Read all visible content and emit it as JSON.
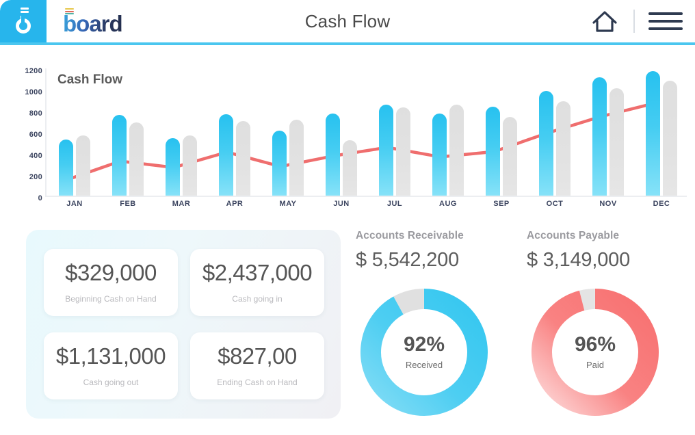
{
  "header": {
    "brand_name": "board",
    "page_title": "Cash Flow",
    "home_icon": "home-icon",
    "menu_icon": "hamburger-menu-icon",
    "accent": "#27b5ec",
    "rule_color": "#4bc6ef"
  },
  "chart_data": {
    "type": "bar",
    "title": "Cash Flow",
    "xlabel": "",
    "ylabel": "",
    "ylim": [
      0,
      1200
    ],
    "yticks": [
      0,
      200,
      400,
      600,
      800,
      1000,
      1200
    ],
    "grid": false,
    "legend": "none",
    "categories": [
      "JAN",
      "FEB",
      "MAR",
      "APR",
      "MAY",
      "JUN",
      "JUL",
      "AUG",
      "SEP",
      "OCT",
      "NOV",
      "DEC"
    ],
    "series": [
      {
        "name": "Cash going in",
        "type": "bar",
        "color": "#27c1ef",
        "values": [
          530,
          760,
          540,
          765,
          615,
          775,
          860,
          775,
          840,
          985,
          1115,
          1175
        ]
      },
      {
        "name": "Cash going out",
        "type": "bar",
        "color": "#e2e2e2",
        "values": [
          565,
          690,
          565,
          705,
          715,
          520,
          835,
          855,
          740,
          890,
          1010,
          1085
        ]
      },
      {
        "name": "Net cash",
        "type": "line",
        "color": "#ef6e6e",
        "values": [
          150,
          325,
          265,
          410,
          275,
          375,
          455,
          365,
          415,
          590,
          745,
          870
        ]
      }
    ]
  },
  "kpi_panel": {
    "cards": [
      {
        "value": "$329,000",
        "label": "Beginning Cash on Hand"
      },
      {
        "value": "$2,437,000",
        "label": "Cash going in"
      },
      {
        "value": "$1,131,000",
        "label": "Cash going out"
      },
      {
        "value": "$827,00",
        "label": "Ending Cash on Hand"
      }
    ]
  },
  "donuts": [
    {
      "title": "Accounts Receivable",
      "amount": "$ 5,542,200",
      "percent_label": "92%",
      "status": "Received",
      "percent": 92,
      "color": "#35c7f0",
      "track_color": "#e0e0e0"
    },
    {
      "title": "Accounts Payable",
      "amount": "$ 3,149,000",
      "percent_label": "96%",
      "status": "Paid",
      "percent": 96,
      "color": "#f87171",
      "track_color": "#e4e4e4"
    }
  ]
}
